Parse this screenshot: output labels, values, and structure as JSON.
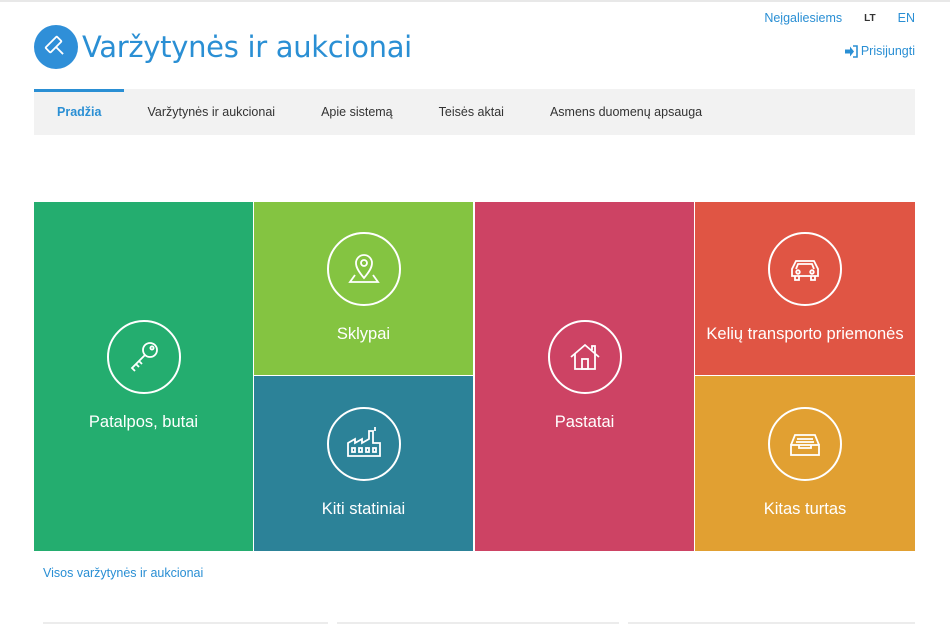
{
  "header": {
    "title": "Varžytynės ir aukcionai"
  },
  "top_links": {
    "accessibility": "Neįgaliesiems",
    "lang_lt": "LT",
    "lang_en": "EN",
    "login": "Prisijungti"
  },
  "nav": {
    "items": [
      {
        "label": "Pradžia"
      },
      {
        "label": "Varžytynės ir aukcionai"
      },
      {
        "label": "Apie sistemą"
      },
      {
        "label": "Teisės aktai"
      },
      {
        "label": "Asmens duomenų apsauga"
      }
    ]
  },
  "tiles": {
    "premises": {
      "label": "Patalpos, butai",
      "icon": "key-icon",
      "color": "#24ad6f"
    },
    "plots": {
      "label": "Sklypai",
      "icon": "location-pin-icon",
      "color": "#84c441"
    },
    "other_structures": {
      "label": "Kiti statiniai",
      "icon": "factory-icon",
      "color": "#2c8298"
    },
    "buildings": {
      "label": "Pastatai",
      "icon": "house-icon",
      "color": "#cd4364"
    },
    "vehicles": {
      "label": "Kelių transporto priemonės",
      "icon": "car-icon",
      "color": "#e05544"
    },
    "other_property": {
      "label": "Kitas turtas",
      "icon": "archive-box-icon",
      "color": "#e1a032"
    }
  },
  "footer_link": "Visos varžytynės ir aukcionai",
  "colors": {
    "accent": "#2a8fd4",
    "nav_background": "#f2f2f2"
  }
}
